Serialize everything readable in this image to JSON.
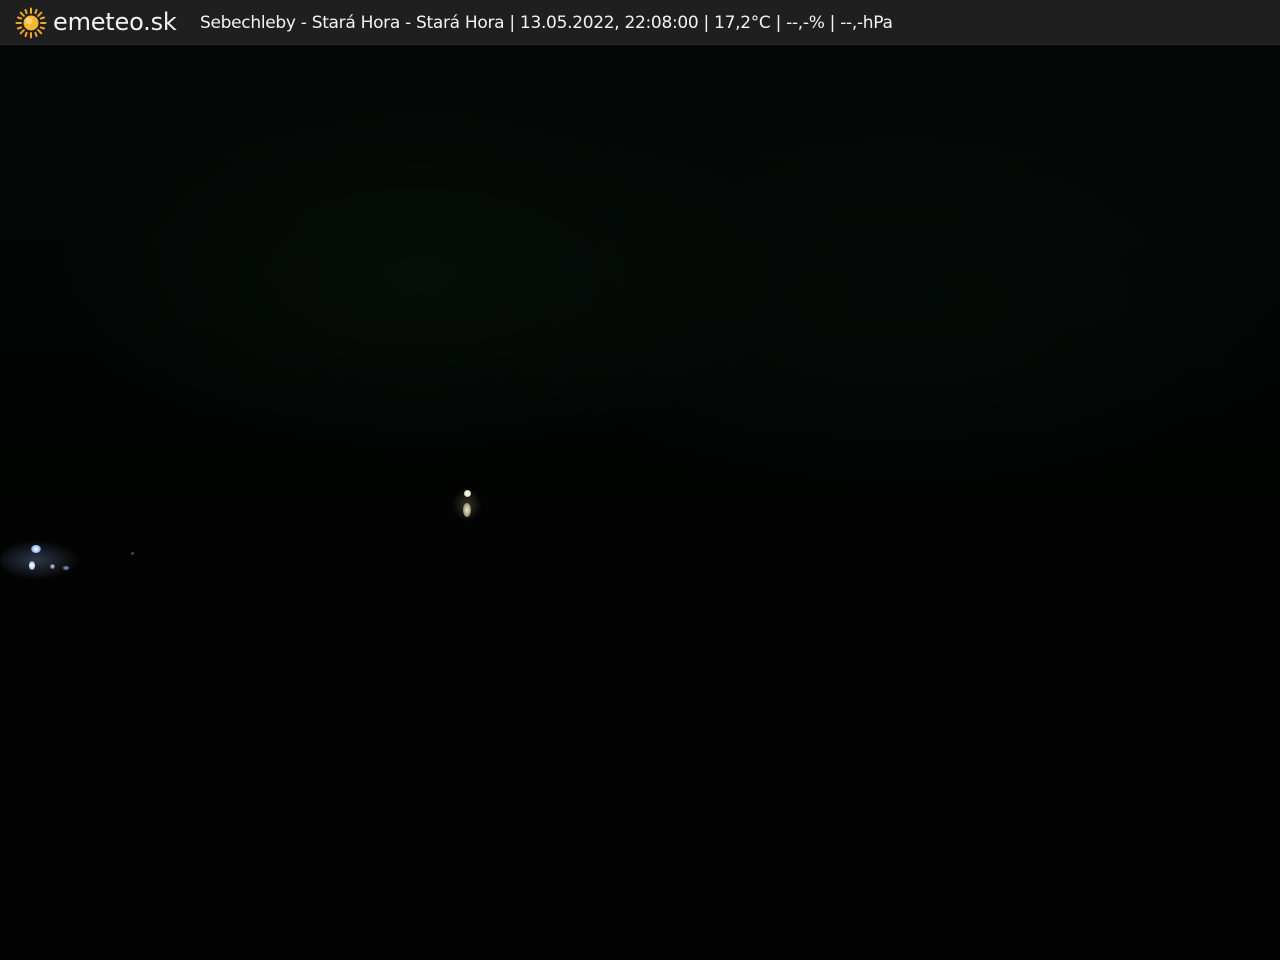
{
  "header": {
    "logo_icon": "sun-icon",
    "logo_text": "emeteo.sk",
    "caption": "Sebechleby - Stará Hora - Stará Hora | 13.05.2022, 22:08:00 | 17,2°C | --,-% | --,-hPa"
  },
  "colors": {
    "header_background": "#1f1f1f",
    "header_text": "#f2f2f2",
    "sun_color": "#f5a623",
    "scene_background": "#020403"
  }
}
